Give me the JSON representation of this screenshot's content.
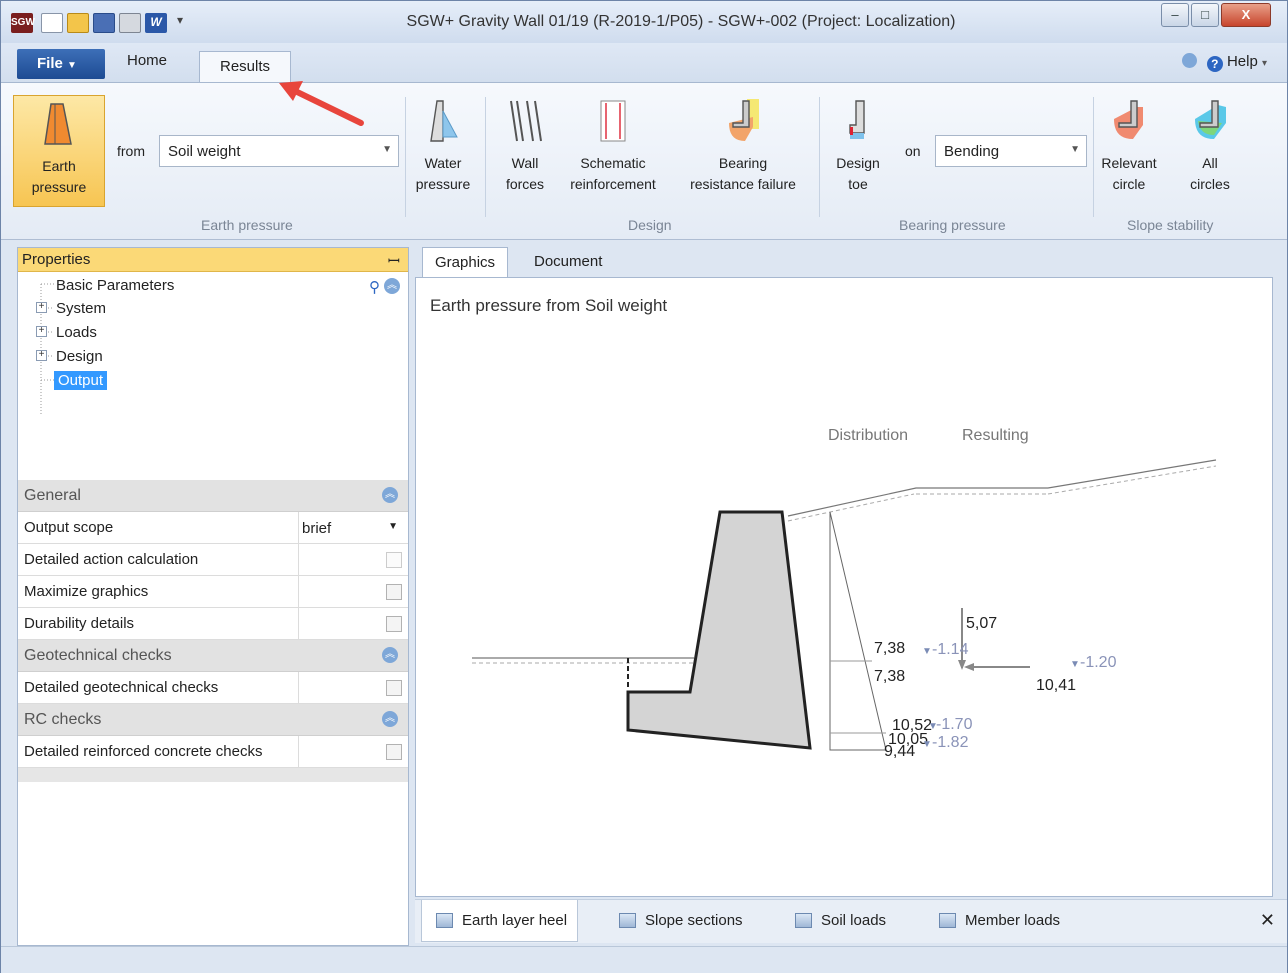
{
  "window": {
    "title": "SGW+ Gravity Wall 01/19 (R-2019-1/P05) - SGW+-002 (Project: Localization)",
    "minimize_label": "‒",
    "maximize_label": "□",
    "close_label": "X"
  },
  "tabs": {
    "file": "File",
    "home": "Home",
    "results": "Results",
    "help": "Help"
  },
  "ribbon": {
    "earth_pressure": {
      "line1": "Earth",
      "line2": "pressure",
      "from_label": "from",
      "from_value": "Soil weight",
      "group": "Earth pressure"
    },
    "water_pressure": {
      "line1": "Water",
      "line2": "pressure"
    },
    "wall_forces": {
      "line1": "Wall",
      "line2": "forces"
    },
    "schematic": {
      "line1": "Schematic",
      "line2": "reinforcement"
    },
    "bearing_failure": {
      "line1": "Bearing",
      "line2": "resistance failure"
    },
    "design_group": "Design",
    "design_toe": {
      "line1": "Design",
      "line2": "toe",
      "on_label": "on",
      "on_value": "Bending"
    },
    "bearing_group": "Bearing pressure",
    "relevant_circle": {
      "line1": "Relevant",
      "line2": "circle"
    },
    "all_circles": {
      "line1": "All",
      "line2": "circles"
    },
    "slope_group": "Slope stability"
  },
  "properties": {
    "title": "Properties",
    "tree": [
      "Basic Parameters",
      "System",
      "Loads",
      "Design",
      "Output"
    ],
    "sections": {
      "general": "General",
      "geotech": "Geotechnical checks",
      "rc": "RC checks"
    },
    "rows": {
      "output_scope": "Output scope",
      "output_scope_value": "brief",
      "detailed_action": "Detailed action calculation",
      "maximize_graphics": "Maximize graphics",
      "durability": "Durability details",
      "detailed_geotech": "Detailed geotechnical checks",
      "detailed_rc": "Detailed reinforced concrete checks"
    }
  },
  "graphics": {
    "tab_graphics": "Graphics",
    "tab_document": "Document",
    "title": "Earth pressure from Soil weight",
    "distribution_label": "Distribution",
    "resulting_label": "Resulting",
    "labels": {
      "v1": "7,38",
      "v2": "7,38",
      "v3": "10,52",
      "v4": "10,05",
      "v5": "9,44",
      "res_vert": "5,07",
      "res_horiz": "10,41",
      "lvl1": "-1.14",
      "lvl2": "-1.20",
      "lvl3": "-1.70",
      "lvl4": "-1.82"
    }
  },
  "bottom_tabs": [
    "Earth layer heel",
    "Slope sections",
    "Soil loads",
    "Member loads"
  ],
  "colors": {
    "accent": "#fbd977",
    "selection": "#3399ff",
    "annotation_arrow": "#e8453c",
    "wall_fill": "#d4d4d4"
  }
}
